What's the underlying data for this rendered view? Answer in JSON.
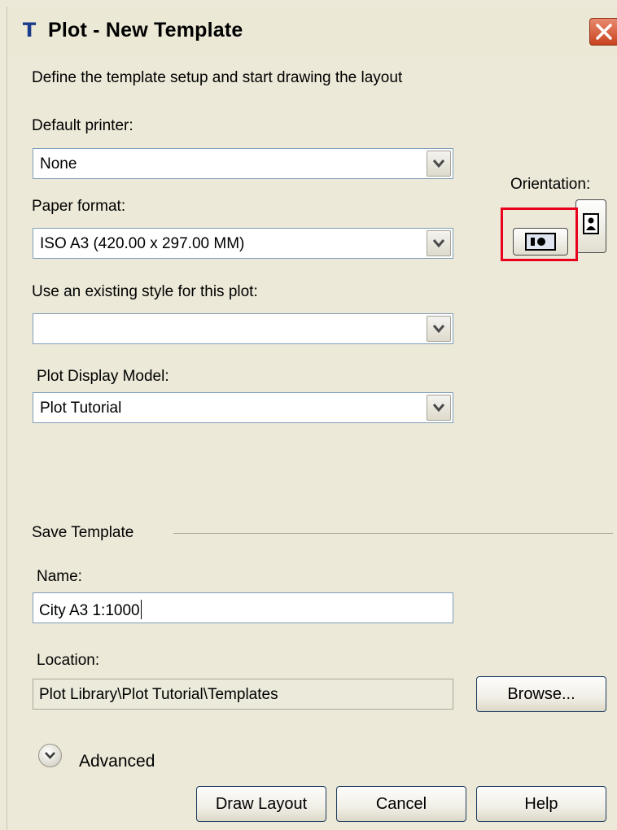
{
  "window": {
    "title": "Plot - New Template"
  },
  "intro": "Define the template setup and start drawing the layout",
  "default_printer": {
    "label": "Default printer:",
    "value": "None"
  },
  "paper_format": {
    "label": "Paper format:",
    "value": "ISO A3 (420.00 x 297.00 MM)"
  },
  "existing_style": {
    "label": "Use an existing style for this plot:",
    "value": ""
  },
  "display_model": {
    "label": "Plot Display Model:",
    "value": "Plot Tutorial"
  },
  "orientation": {
    "label": "Orientation:",
    "selected": "landscape",
    "highlight_color": "#e8001c"
  },
  "save_template": {
    "heading": "Save Template",
    "name_label": "Name:",
    "name_value": "City A3 1:1000",
    "location_label": "Location:",
    "location_value": "Plot Library\\Plot Tutorial\\Templates",
    "browse_label": "Browse..."
  },
  "advanced": {
    "label": "Advanced",
    "icon": "chevron-down-icon"
  },
  "buttons": {
    "draw_layout": "Draw Layout",
    "cancel": "Cancel",
    "help": "Help"
  },
  "icons": {
    "app": "app-logo-icon",
    "close": "close-icon",
    "dropdown": "chevron-down-icon",
    "landscape": "landscape-orientation-icon",
    "portrait": "portrait-orientation-icon"
  }
}
